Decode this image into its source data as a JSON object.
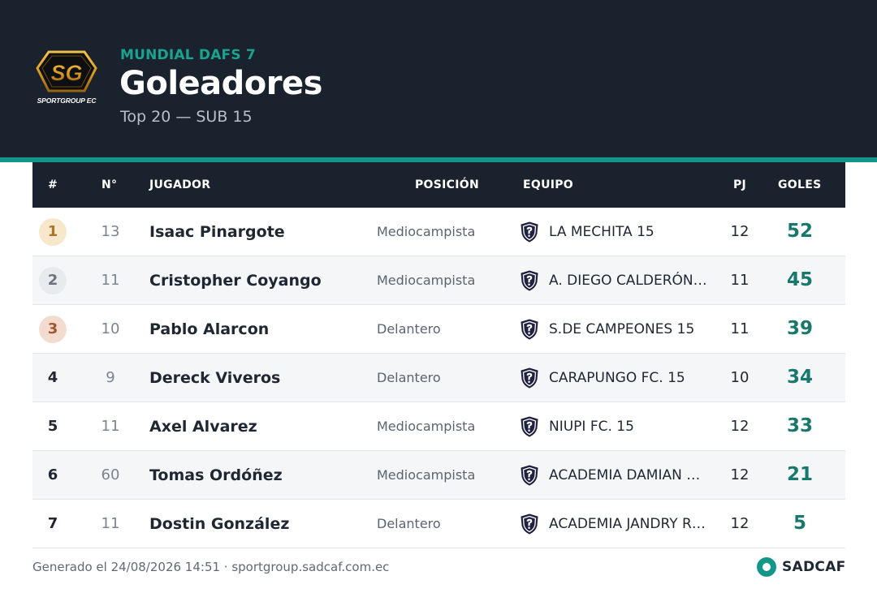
{
  "header": {
    "logo_text": "SPORTGROUP EC",
    "kicker": "MUNDIAL DAFS 7",
    "title": "Goleadores",
    "subtitle": "Top 20 — SUB 15"
  },
  "colors": {
    "header_bg": "#19222d",
    "accent": "#14978a",
    "goals": "#17786b",
    "gold": "#a9762a",
    "silver": "#6b7480",
    "bronze": "#a7552f"
  },
  "table": {
    "columns": {
      "rank": "#",
      "number": "N°",
      "player": "JUGADOR",
      "position": "POSICIÓN",
      "team": "EQUIPO",
      "played": "PJ",
      "goals": "GOLES"
    },
    "team_icon": "team-shield-icon",
    "rows": [
      {
        "rank": "1",
        "number": "13",
        "player": "Isaac Pinargote",
        "position": "Mediocampista",
        "team": "LA MECHITA 15",
        "played": "12",
        "goals": "52"
      },
      {
        "rank": "2",
        "number": "11",
        "player": "Cristopher Coyango",
        "position": "Mediocampista",
        "team": "A. DIEGO CALDERÓN …",
        "played": "11",
        "goals": "45"
      },
      {
        "rank": "3",
        "number": "10",
        "player": "Pablo Alarcon",
        "position": "Delantero",
        "team": "S.DE CAMPEONES 15",
        "played": "11",
        "goals": "39"
      },
      {
        "rank": "4",
        "number": "9",
        "player": "Dereck Viveros",
        "position": "Delantero",
        "team": "CARAPUNGO FC. 15",
        "played": "10",
        "goals": "34"
      },
      {
        "rank": "5",
        "number": "11",
        "player": "Axel Alvarez",
        "position": "Mediocampista",
        "team": "NIUPI FC. 15",
        "played": "12",
        "goals": "33"
      },
      {
        "rank": "6",
        "number": "60",
        "player": "Tomas Ordóñez",
        "position": "Mediocampista",
        "team": "ACADEMIA DAMIAN …",
        "played": "12",
        "goals": "21"
      },
      {
        "rank": "7",
        "number": "11",
        "player": "Dostin González",
        "position": "Delantero",
        "team": "ACADEMIA JANDRY R…",
        "played": "12",
        "goals": "5"
      }
    ]
  },
  "footer": {
    "generated": "Generado el 24/08/2026 14:51 · sportgroup.sadcaf.com.ec",
    "brand": "SADCAF"
  }
}
